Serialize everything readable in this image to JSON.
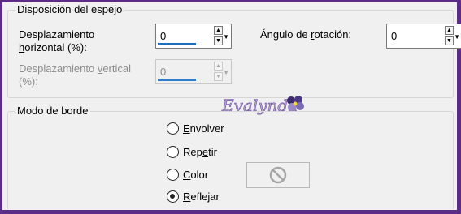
{
  "mirror_group": {
    "title": "Disposición del espejo",
    "horizontal": {
      "label_line1": "Desplazamiento",
      "label_line2_pre": "",
      "label_line2_underlined": "h",
      "label_line2_post": "orizontal (%):",
      "value": "0"
    },
    "vertical": {
      "label_line1_pre": "Desplazamiento ",
      "label_line1_underlined": "v",
      "label_line1_post": "ertical",
      "label_line2": "(%):",
      "value": "0"
    },
    "rotation": {
      "label_pre": "Ángulo de ",
      "label_underlined": "r",
      "label_post": "otación:",
      "value": "0"
    }
  },
  "watermark": {
    "text": "Evalynda"
  },
  "border_group": {
    "title": "Modo de borde",
    "options": [
      {
        "underlined": "E",
        "rest": "nvolver",
        "selected": false
      },
      {
        "pre": "Rep",
        "underlined": "e",
        "rest": "tir",
        "selected": false
      },
      {
        "underlined": "C",
        "rest": "olor",
        "selected": false
      },
      {
        "underlined": "R",
        "rest": "eflejar",
        "selected": true
      }
    ]
  },
  "colors": {
    "frame": "#5c2d86",
    "panel": "#f0f0f0",
    "accent_bar": "#1a6fc3",
    "disabled_text": "#8d8d8d"
  }
}
